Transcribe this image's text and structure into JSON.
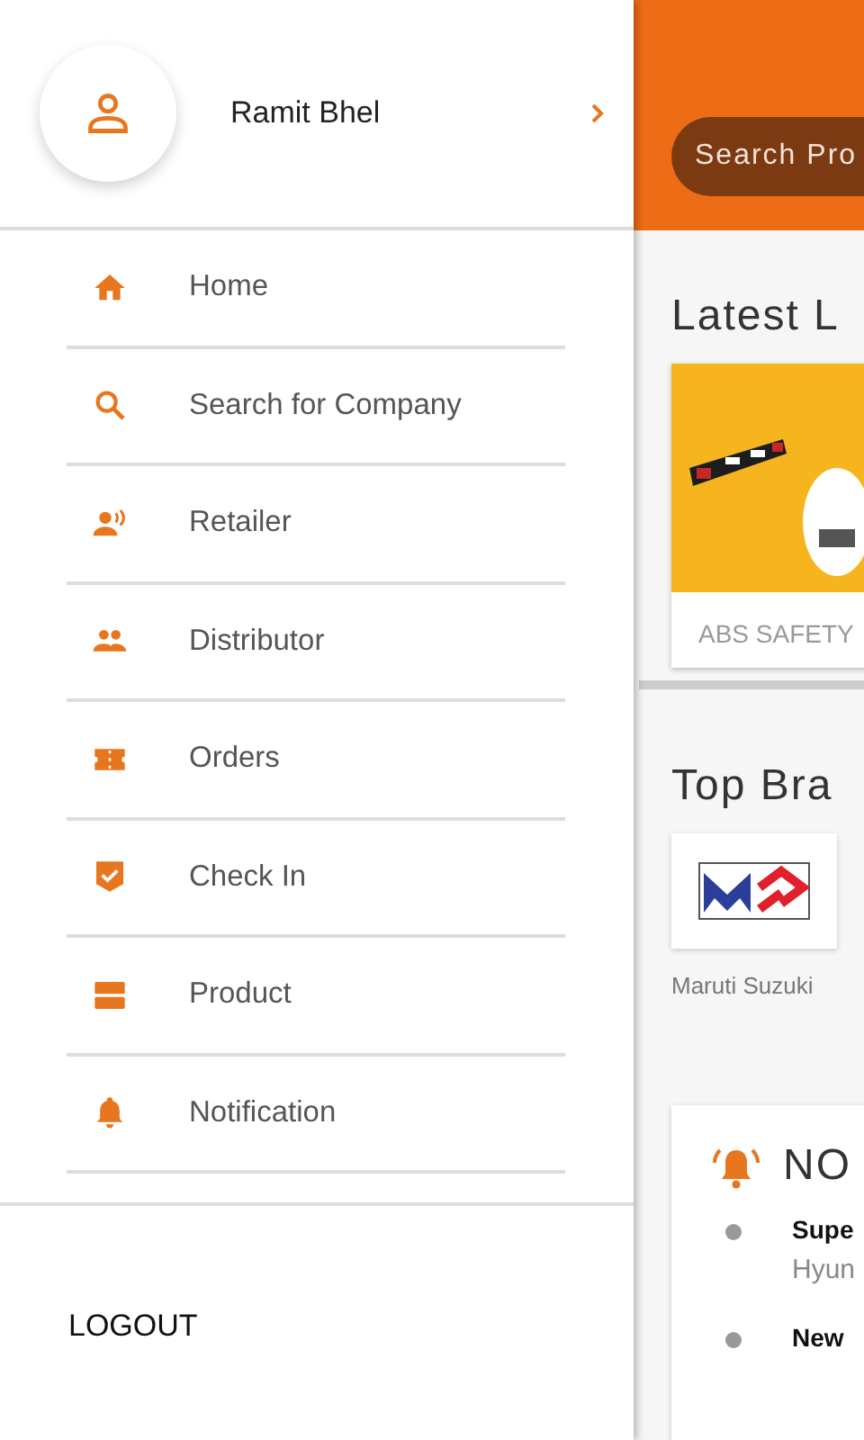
{
  "drawer": {
    "user": {
      "name": "Ramit Bhel"
    },
    "menu": [
      {
        "label": "Home"
      },
      {
        "label": "Search for Company"
      },
      {
        "label": "Retailer"
      },
      {
        "label": "Distributor"
      },
      {
        "label": "Orders"
      },
      {
        "label": "Check In"
      },
      {
        "label": "Product"
      },
      {
        "label": "Notification"
      }
    ],
    "logout": "LOGOUT"
  },
  "main": {
    "search": {
      "placeholder": "Search Pro"
    },
    "latest": {
      "title": "Latest L",
      "products": [
        {
          "kind": "picture",
          "caption": "ABS SAFETY"
        }
      ]
    },
    "brands": {
      "title": "Top Bra",
      "items": [
        {
          "name": "Maruti Suzuki"
        }
      ]
    },
    "notifications": {
      "title": "NO",
      "items": [
        {
          "title": "Supe",
          "subtitle": "Hyun"
        },
        {
          "title": "New"
        }
      ]
    }
  }
}
